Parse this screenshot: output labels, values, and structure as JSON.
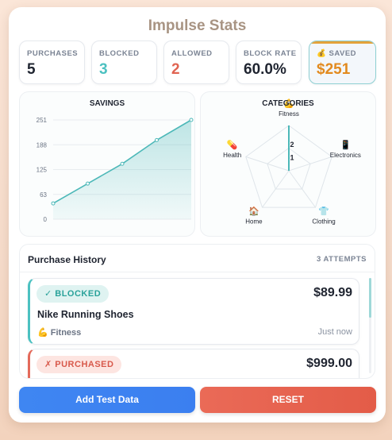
{
  "title": "Impulse Stats",
  "stats": [
    {
      "label": "PURCHASES",
      "value": "5",
      "color": "#1f2430"
    },
    {
      "label": "BLOCKED",
      "value": "3",
      "color": "#4cc1c1"
    },
    {
      "label": "ALLOWED",
      "value": "2",
      "color": "#e06452"
    },
    {
      "label": "BLOCK RATE",
      "value": "60.0%",
      "color": "#1f2430"
    },
    {
      "label": "SAVED",
      "value": "$251",
      "color": "#e28a1e",
      "icon": "money-bag-icon"
    }
  ],
  "savings": {
    "title": "SAVINGS",
    "chart_data": {
      "type": "area",
      "title": "SAVINGS",
      "yticks": [
        "251",
        "188",
        "125",
        "63",
        "0"
      ],
      "ylim": [
        0,
        251
      ],
      "x": [
        0,
        1,
        2,
        3,
        4
      ],
      "values": [
        40,
        90,
        140,
        200,
        251
      ],
      "grid": true,
      "color": "#4cb8b8"
    }
  },
  "categories": {
    "title": "CATEGORIES",
    "chart_data": {
      "type": "radar",
      "title": "CATEGORIES",
      "axes": [
        {
          "label": "Fitness",
          "icon": "flexed-biceps-icon",
          "value": 2
        },
        {
          "label": "Electronics",
          "icon": "mobile-phone-icon",
          "value": 0
        },
        {
          "label": "Clothing",
          "icon": "t-shirt-icon",
          "value": 0
        },
        {
          "label": "Home",
          "icon": "house-icon",
          "value": 0
        },
        {
          "label": "Health",
          "icon": "pill-icon",
          "value": 0
        }
      ],
      "tick_labels": [
        "1",
        "2"
      ],
      "rmax": 2,
      "color": "#4cb8b8"
    }
  },
  "history": {
    "title": "Purchase History",
    "count": "3 ATTEMPTS",
    "items": [
      {
        "status": "✓ BLOCKED",
        "type": "blocked",
        "price": "$89.99",
        "name": "Nike Running Shoes",
        "category": "Fitness",
        "category_icon": "flexed-biceps-icon",
        "time": "Just now"
      },
      {
        "status": "✗ PURCHASED",
        "type": "purchased",
        "price": "$999.00"
      }
    ]
  },
  "buttons": {
    "add": "Add Test Data",
    "reset": "RESET"
  },
  "colors": {
    "accent_teal": "#4cc1c1",
    "accent_red": "#e35c48",
    "accent_blue": "#3f86f2",
    "accent_orange": "#e28a1e"
  }
}
